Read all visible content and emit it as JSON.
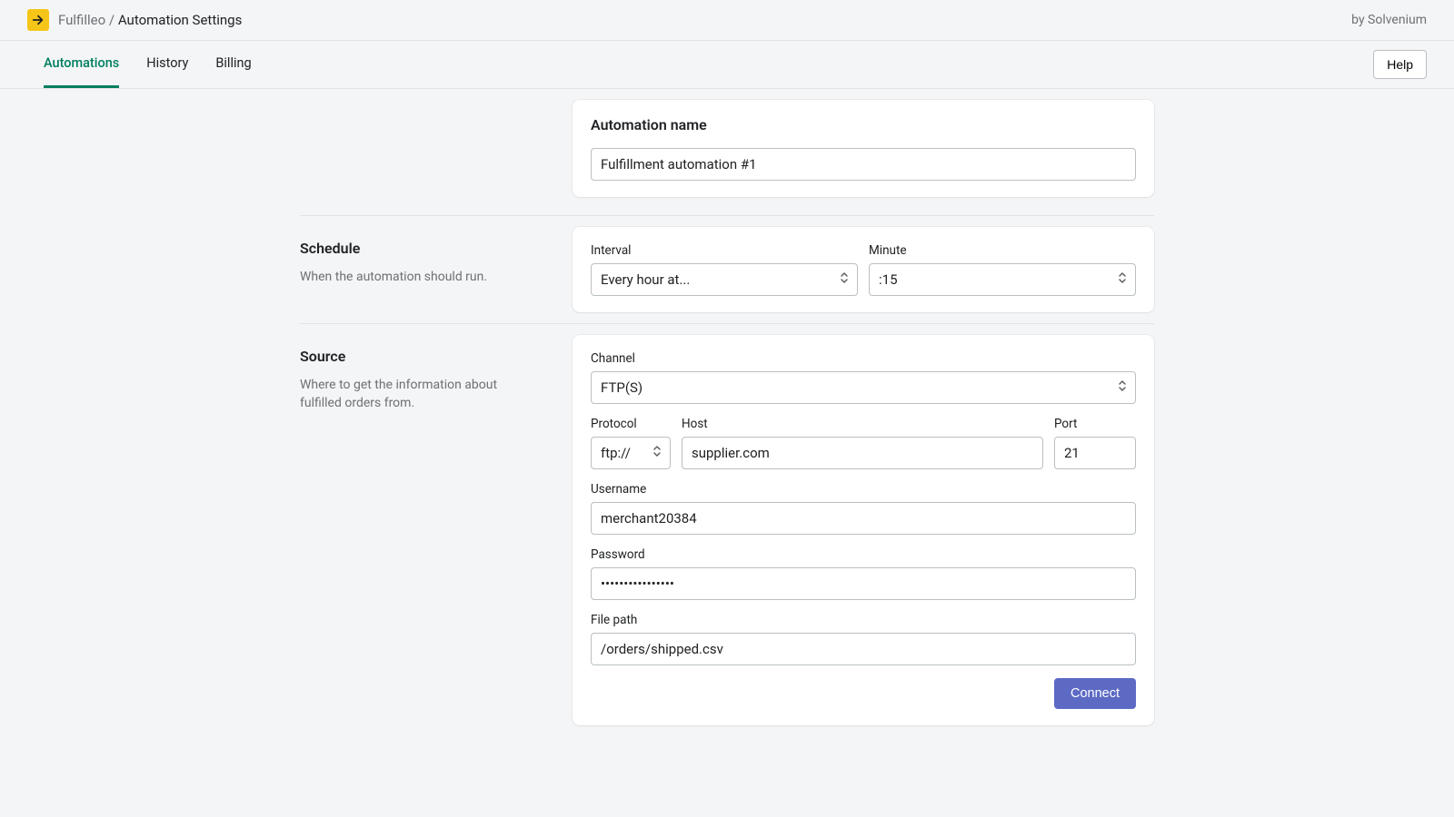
{
  "header": {
    "app_name": "Fulfilleo",
    "separator": "/",
    "page_title": "Automation Settings",
    "by_line": "by Solvenium"
  },
  "tabs": {
    "items": [
      {
        "label": "Automations",
        "active": true
      },
      {
        "label": "History",
        "active": false
      },
      {
        "label": "Billing",
        "active": false
      }
    ],
    "help_label": "Help"
  },
  "name_section": {
    "card_title": "Automation name",
    "value": "Fulfillment automation #1"
  },
  "schedule_section": {
    "title": "Schedule",
    "description": "When the automation should run.",
    "interval_label": "Interval",
    "interval_value": "Every hour at...",
    "minute_label": "Minute",
    "minute_value": ":15"
  },
  "source_section": {
    "title": "Source",
    "description": "Where to get the information about fulfilled orders from.",
    "channel_label": "Channel",
    "channel_value": "FTP(S)",
    "protocol_label": "Protocol",
    "protocol_value": "ftp://",
    "host_label": "Host",
    "host_value": "supplier.com",
    "port_label": "Port",
    "port_value": "21",
    "username_label": "Username",
    "username_value": "merchant20384",
    "password_label": "Password",
    "password_value": "••••••••••••••••",
    "filepath_label": "File path",
    "filepath_value": "/orders/shipped.csv",
    "connect_label": "Connect"
  }
}
